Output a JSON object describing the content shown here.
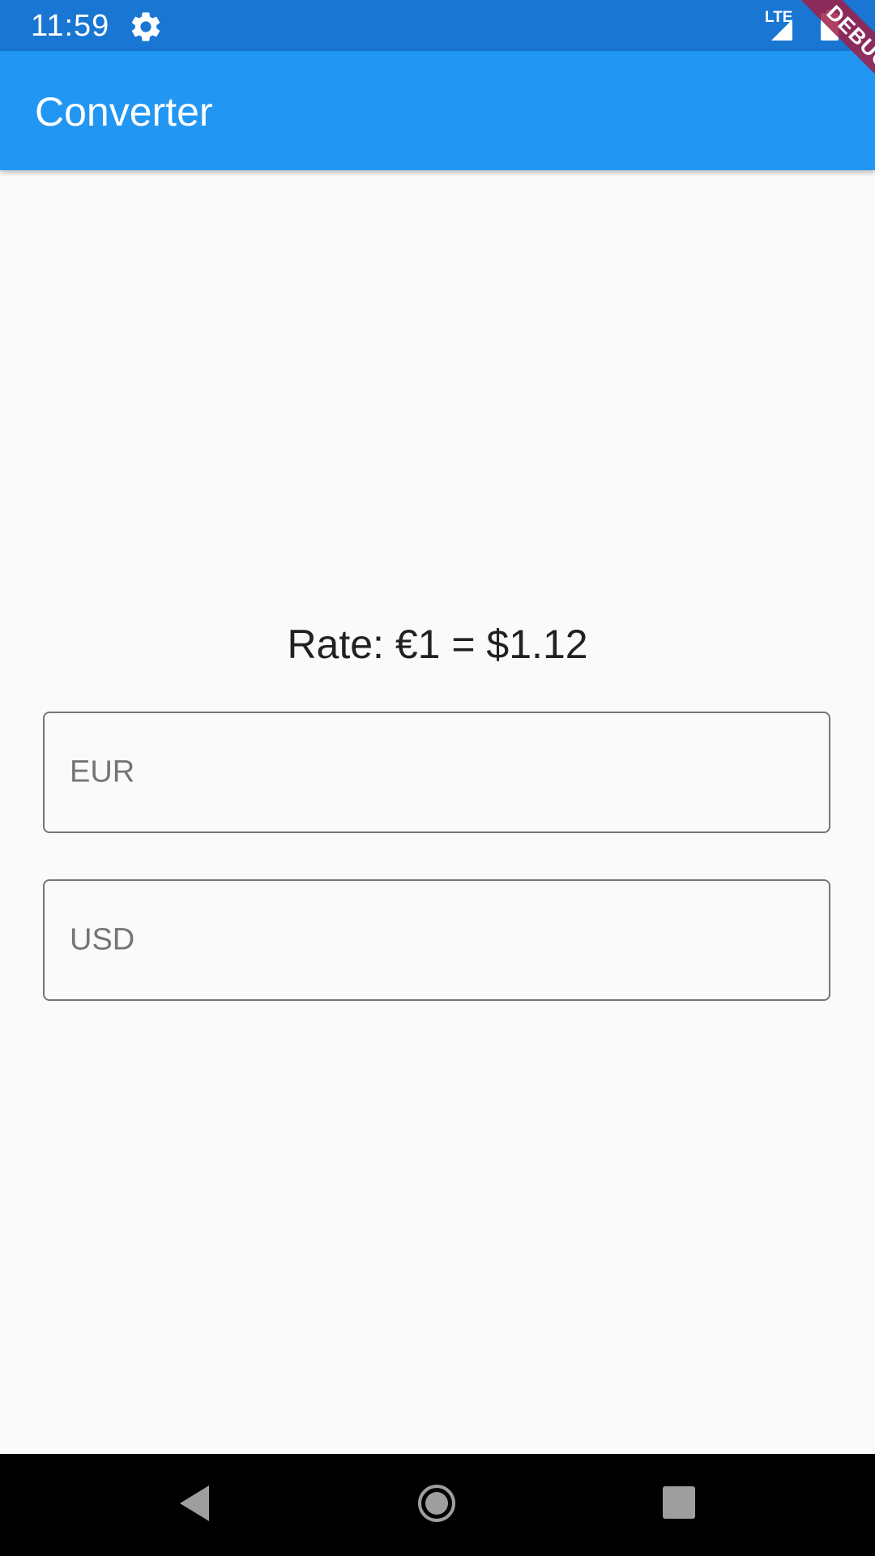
{
  "status_bar": {
    "time": "11:59",
    "network_label": "LTE",
    "icons": [
      "gear-icon",
      "signal-icon",
      "battery-icon"
    ]
  },
  "app_bar": {
    "title": "Converter"
  },
  "debug_banner": {
    "label": "DEBUG"
  },
  "main": {
    "rate_text": "Rate: €1 = $1.12",
    "eur_field": {
      "label": "EUR",
      "value": ""
    },
    "usd_field": {
      "label": "USD",
      "value": ""
    }
  },
  "nav_bar": {
    "icons": [
      "back-icon",
      "home-icon",
      "recents-icon"
    ]
  },
  "colors": {
    "status_bar": "#1976d2",
    "app_bar": "#2196f3",
    "background": "#fafafa",
    "debug_banner": "#a01e46",
    "field_border": "#757575",
    "nav_bar": "#000000"
  }
}
